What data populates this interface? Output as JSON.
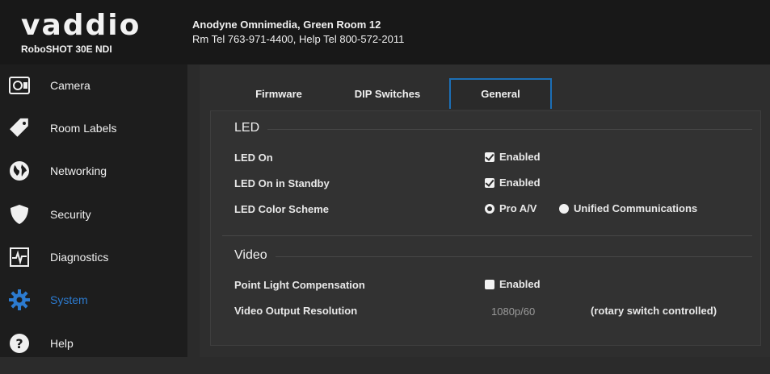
{
  "brand": {
    "logo_text": "vaddio",
    "model": "RoboSHOT 30E NDI"
  },
  "room": {
    "name": "Anodyne Omnimedia, Green Room 12",
    "contact": "Rm Tel 763-971-4400, Help Tel 800-572-2011"
  },
  "sidebar": {
    "items": [
      {
        "label": "Camera",
        "icon": "camera-icon"
      },
      {
        "label": "Room Labels",
        "icon": "tag-icon"
      },
      {
        "label": "Networking",
        "icon": "globe-icon"
      },
      {
        "label": "Security",
        "icon": "shield-icon"
      },
      {
        "label": "Diagnostics",
        "icon": "pulse-icon"
      },
      {
        "label": "System",
        "icon": "gear-icon",
        "active": true
      },
      {
        "label": "Help",
        "icon": "help-icon"
      }
    ]
  },
  "tabs": [
    {
      "label": "Firmware"
    },
    {
      "label": "DIP Switches"
    },
    {
      "label": "General",
      "active": true
    }
  ],
  "led": {
    "title": "LED",
    "led_on": {
      "label": "LED On",
      "value_label": "Enabled",
      "checked": true
    },
    "led_standby": {
      "label": "LED On in Standby",
      "value_label": "Enabled",
      "checked": true
    },
    "color_scheme": {
      "label": "LED Color Scheme",
      "options": [
        "Pro A/V",
        "Unified Communications"
      ],
      "selected": "Pro A/V"
    }
  },
  "video": {
    "title": "Video",
    "plc": {
      "label": "Point Light Compensation",
      "value_label": "Enabled",
      "checked": false
    },
    "resolution": {
      "label": "Video Output Resolution",
      "value": "1080p/60",
      "note": "(rotary switch controlled)"
    }
  },
  "colors": {
    "accent": "#1c6fb6",
    "active_nav": "#2c7bd0"
  }
}
